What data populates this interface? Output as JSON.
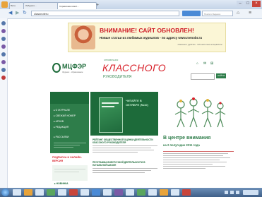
{
  "browser": {
    "tabs": [
      {
        "label": "Вкла"
      },
      {
        "label": "Лабурати..."
      },
      {
        "label": "Справочник класс..."
      }
    ],
    "address": "classnoteru",
    "search_placeholder": "Поиск в Яндексе"
  },
  "banner": {
    "title": "ВНИМАНИЕ! САЙТ ОБНОВЛЕН!",
    "subtitle": "Новые статьи из любимых журналов - по адресу www.menobr.ru",
    "footnote": "освоение и удобство - тебя настолько не ворвалось!"
  },
  "site": {
    "logo_title": "МЦФЭР",
    "logo_subtitle": "Журнал · образование",
    "journal_small": "СПРАВОЧНИК",
    "journal_big": "КЛАССНОГО",
    "journal_sub": "РУКОВОДИТЕЛЯ",
    "search_button": "НАЙТИ"
  },
  "menu": [
    {
      "label": "О ЖУРНАЛЕ"
    },
    {
      "label": "СВЕЖИЙ НОМЕР"
    },
    {
      "label": "АРХИВ"
    },
    {
      "label": "РЕДАКЦИЯ"
    }
  ],
  "menu_extra": {
    "label": "РАССЫЛКИ"
  },
  "subscribe": {
    "label": "ПОДПИСКА И ОНЛАЙН-ВЕРСИЯ"
  },
  "bottom_link": {
    "label": "НОВИНКА"
  },
  "issue_promo": {
    "label": "ЧИТАЙТЕ В ОКТЯБРЕ (№10)"
  },
  "articles": [
    {
      "title": "РЕЙТИНГ ОБЩЕСТВЕННОЙ ОЦЕНКИ ДЕЯТЕЛЬНОСТИ КЛАССНОГО РУКОВОДИТЕЛЯ"
    },
    {
      "title": "ПРОГРАММА ВНЕУРОЧНОЙ ДЕЯТЕЛЬНОСТИ В НАЧАЛЬНОЙ ШКОЛЕ"
    }
  ],
  "center_focus": {
    "title": "В центре внимания",
    "date": "на 2 полугодие 2011 года"
  }
}
